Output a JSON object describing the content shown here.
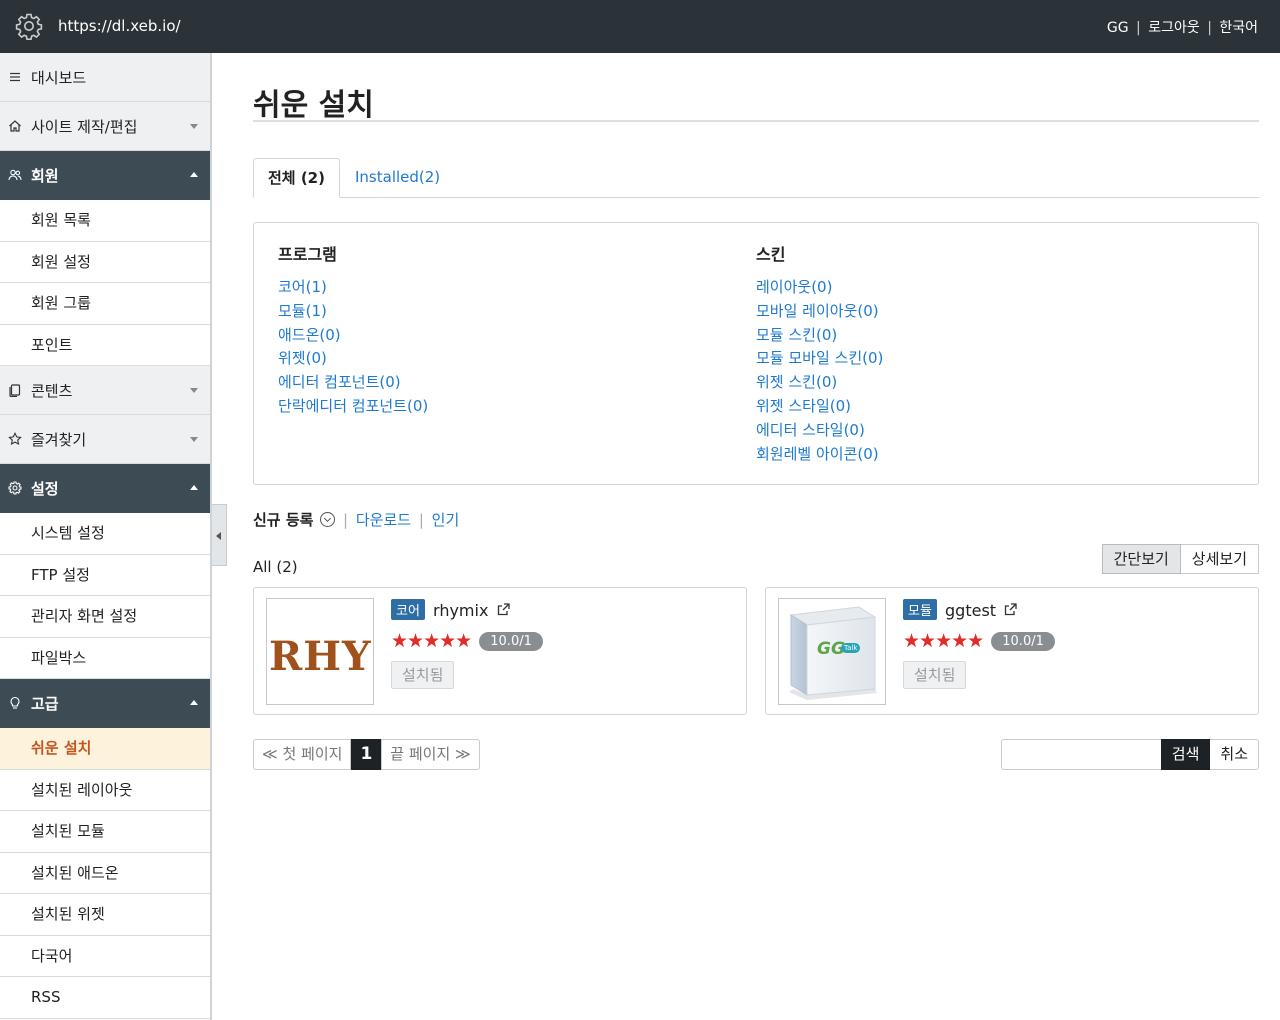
{
  "header": {
    "url": "https://dl.xeb.io/",
    "user": "GG",
    "logout": "로그아웃",
    "language": "한국어",
    "separator": "|"
  },
  "sidebar": {
    "dashboard": "대시보드",
    "site_edit": "사이트 제작/편집",
    "member": {
      "label": "회원",
      "items": [
        "회원 목록",
        "회원 설정",
        "회원 그룹",
        "포인트"
      ]
    },
    "contents": "콘텐츠",
    "favorites": "즐겨찾기",
    "settings": {
      "label": "설정",
      "items": [
        "시스템 설정",
        "FTP 설정",
        "관리자 화면 설정",
        "파일박스"
      ]
    },
    "advanced": {
      "label": "고급",
      "items": [
        "쉬운 설치",
        "설치된 레이아웃",
        "설치된 모듈",
        "설치된 애드온",
        "설치된 위젯",
        "다국어",
        "RSS"
      ]
    }
  },
  "main": {
    "title": "쉬운 설치",
    "tabs": [
      "전체 (2)",
      "Installed(2)"
    ],
    "categories": {
      "program": {
        "heading": "프로그램",
        "links": [
          "코어(1)",
          "모듈(1)",
          "애드온(0)",
          "위젯(0)",
          "에디터 컴포넌트(0)",
          "단락에디터 컴포넌트(0)"
        ]
      },
      "skin": {
        "heading": "스킨",
        "links": [
          "레이아웃(0)",
          "모바일 레이아웃(0)",
          "모듈 스킨(0)",
          "모듈 모바일 스킨(0)",
          "위젯 스킨(0)",
          "위젯 스타일(0)",
          "에디터 스타일(0)",
          "회원레벨 아이콘(0)"
        ]
      }
    },
    "sort": {
      "current": "신규 등록",
      "download": "다운로드",
      "popular": "인기",
      "separator": "|"
    },
    "all_count": "All (2)",
    "view_toggle": [
      "간단보기",
      "상세보기"
    ],
    "packages": [
      {
        "type": "코어",
        "name": "rhymix",
        "stars": "★★★★★",
        "rating": "10.0/1",
        "status": "설치됨",
        "thumb_text": "RHY"
      },
      {
        "type": "모듈",
        "name": "ggtest",
        "stars": "★★★★★",
        "rating": "10.0/1",
        "status": "설치됨",
        "thumb_text": "GG",
        "thumb_badge": "Talk"
      }
    ],
    "pagination": {
      "first": "≪ 첫 페이지",
      "current": "1",
      "last": "끝 페이지 ≫"
    },
    "search": {
      "placeholder": "",
      "button": "검색",
      "cancel": "취소"
    }
  },
  "colors": {
    "header_bg": "#2b3338",
    "sidebar_active_bg": "#3c4b54",
    "link": "#1e7ad0",
    "current_item_bg": "#fdf3dd",
    "current_item_text": "#c4551c",
    "badge": "#2e6ea5",
    "stars": "#e02b2b"
  }
}
